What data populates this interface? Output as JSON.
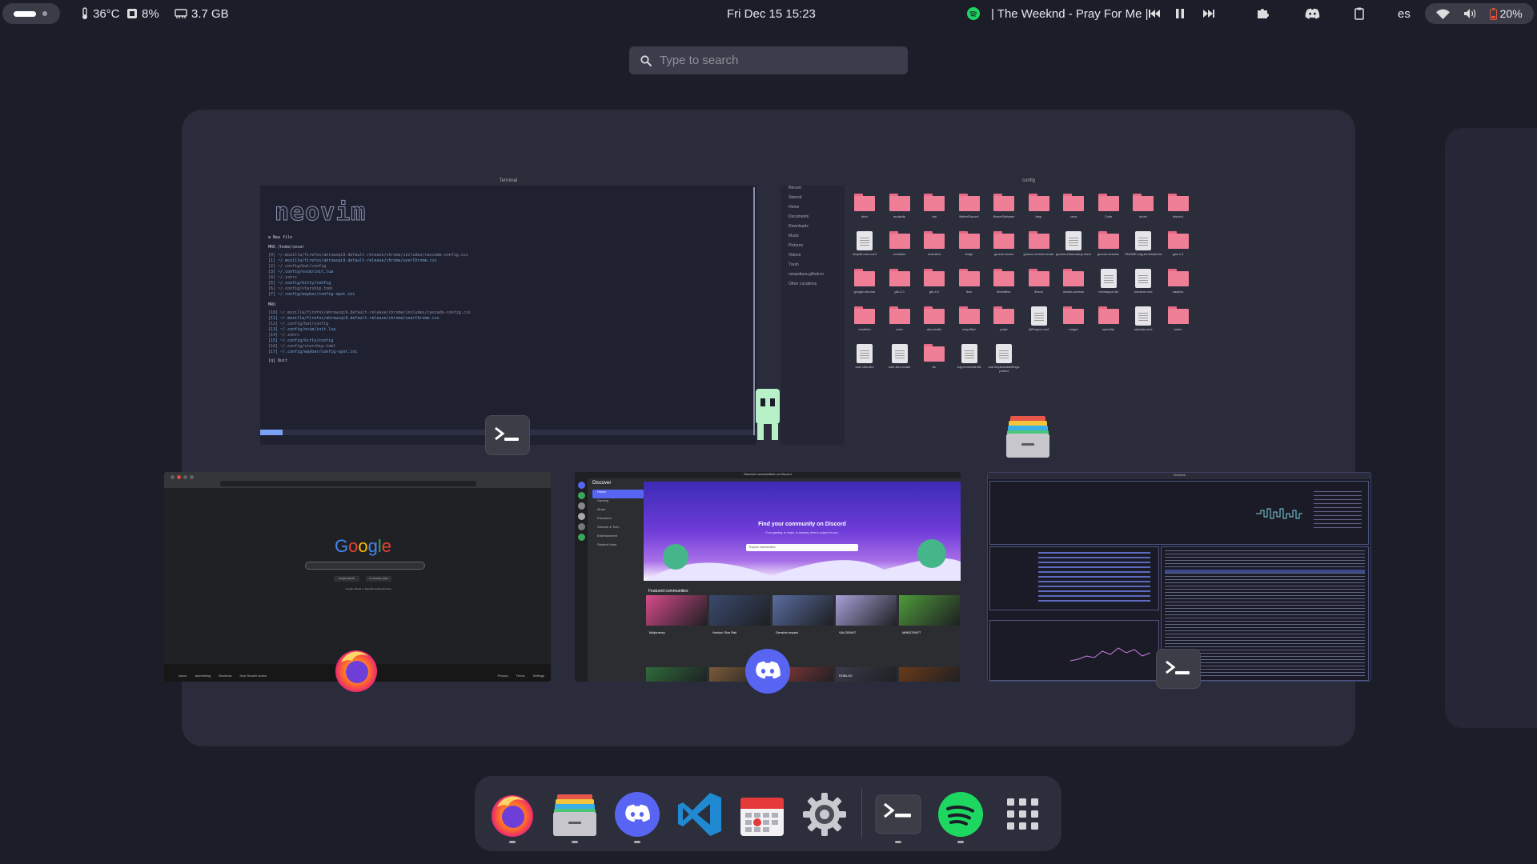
{
  "topbar": {
    "temperature": "36°C",
    "cpu": "8%",
    "memory": "3.7 GB",
    "clock": "Fri Dec 15  15:23",
    "now_playing": "| The Weeknd  -  Pray For Me |",
    "language": "es",
    "battery": "20%"
  },
  "search": {
    "placeholder": "Type to search"
  },
  "windows": {
    "terminal1": {
      "title": "Terminal",
      "logo": "neovim",
      "new_file": "New file",
      "mru_header": "MRU /home/cesar",
      "mru_items": [
        "[0]  ~/.mozilla/firefox/ahrowxqi9.default-release/chrome/includes/cascade-config.css",
        "[1]  ~/.mozilla/firefox/ahrowxqi9.default-release/chrome/userChrome.css",
        "[2]  ~/.config/bat/config",
        "[3]  ~/.config/nvim/init.lua",
        "[4]  ~/.zshrc",
        "[5]  ~/.config/kitty/config",
        "[6]  ~/.config/starship.toml",
        "[7]  ~/.config/waybar/config-spot.ini"
      ],
      "mru2_header": "MRU",
      "mru2_items": [
        "[10]  ~/.mozilla/firefox/ahrowxqi9.default-release/chrome/includes/cascade-config.css",
        "[11]  ~/.mozilla/firefox/ahrowxqi9.default-release/chrome/userChrome.css",
        "[12]  ~/.config/bat/config",
        "[13]  ~/.config/nvim/init.lua",
        "[14]  ~/.zshrc",
        "[15]  ~/.config/kitty/config",
        "[16]  ~/.config/starship.toml",
        "[17]  ~/.config/waybar/config-spot.ini"
      ],
      "quit": "[q]  Quit",
      "mode": "NORMAL"
    },
    "files": {
      "title": "config",
      "sidebar": [
        "Recent",
        "Starred",
        "Home",
        "Documents",
        "Downloads",
        "Music",
        "Pictures",
        "Videos",
        "Trash",
        "ceepottura.github.io",
        "Other Locations"
      ],
      "items": [
        {
          "name": "alert",
          "kind": "folder"
        },
        {
          "name": "audacity",
          "kind": "folder"
        },
        {
          "name": "bat",
          "kind": "folder"
        },
        {
          "name": "BetterDiscord",
          "kind": "folder"
        },
        {
          "name": "BraveSoftware",
          "kind": "folder"
        },
        {
          "name": "btop",
          "kind": "folder"
        },
        {
          "name": "cava",
          "kind": "folder"
        },
        {
          "name": "Code",
          "kind": "folder"
        },
        {
          "name": "dconf",
          "kind": "folder"
        },
        {
          "name": "discord",
          "kind": "folder"
        },
        {
          "name": "dmydir-user.conf",
          "kind": "file"
        },
        {
          "name": "evolution",
          "kind": "folder"
        },
        {
          "name": "evolution",
          "kind": "folder"
        },
        {
          "name": "fonge",
          "kind": "folder"
        },
        {
          "name": "gnome-boxes",
          "kind": "folder"
        },
        {
          "name": "gnome-control-center",
          "kind": "folder"
        },
        {
          "name": "gnome-initial-setup-done",
          "kind": "file"
        },
        {
          "name": "gnome-session",
          "kind": "folder"
        },
        {
          "name": "GNOME-xdg-terminals.list",
          "kind": "file"
        },
        {
          "name": "goa-1.0",
          "kind": "folder"
        },
        {
          "name": "google-chrome",
          "kind": "folder"
        },
        {
          "name": "gtk-2.0",
          "kind": "folder"
        },
        {
          "name": "gtk-4.0",
          "kind": "folder"
        },
        {
          "name": "ibus",
          "kind": "folder"
        },
        {
          "name": "libreoffice",
          "kind": "folder"
        },
        {
          "name": "libsoil",
          "kind": "folder"
        },
        {
          "name": "media-controls",
          "kind": "folder"
        },
        {
          "name": "mimeapps.list",
          "kind": "file"
        },
        {
          "name": "monitors.xml",
          "kind": "file"
        },
        {
          "name": "nautilus",
          "kind": "folder"
        },
        {
          "name": "neofetch",
          "kind": "folder"
        },
        {
          "name": "nvim",
          "kind": "folder"
        },
        {
          "name": "obs-studio",
          "kind": "folder"
        },
        {
          "name": "onlyoffice",
          "kind": "folder"
        },
        {
          "name": "pulse",
          "kind": "folder"
        },
        {
          "name": "QtProject.conf",
          "kind": "file"
        },
        {
          "name": "ranger",
          "kind": "folder"
        },
        {
          "name": "spicetify",
          "kind": "folder"
        },
        {
          "name": "starship.toml",
          "kind": "file"
        },
        {
          "name": "totem",
          "kind": "folder"
        },
        {
          "name": "user-dirs.dirs",
          "kind": "file"
        },
        {
          "name": "user-dirs.locale",
          "kind": "file"
        },
        {
          "name": "vlc",
          "kind": "folder"
        },
        {
          "name": "xdg-terminals.list",
          "kind": "file"
        },
        {
          "name": ".zsh-keyboardsettings-ported",
          "kind": "file"
        }
      ]
    },
    "chrome": {
      "logo": "Google",
      "btn1": "Google Search",
      "btn2": "I'm Feeling Lucky",
      "lang_text": "Google offered in:  Español (Latinoamérica)",
      "footer_left": [
        "About",
        "Advertising",
        "Business",
        "How Search works"
      ],
      "footer_right": [
        "Privacy",
        "Terms",
        "Settings"
      ]
    },
    "discord": {
      "title": "Discord",
      "window_title": "Discover communities on Discord",
      "header": "Discover",
      "nav": [
        "Home",
        "Gaming",
        "Music",
        "Education",
        "Science & Tech",
        "Entertainment",
        "Student Hubs"
      ],
      "hero_title": "Find your community on Discord",
      "hero_sub": "From gaming, to music, to learning, there's a place for you.",
      "hero_input": "Explore communities",
      "featured": "Featured communities",
      "communities": [
        "Midjourney",
        "Honkai: Star Rail",
        "Genshin Impact",
        "VALORANT",
        "MINECRAFT",
        "",
        "",
        "",
        "ROBLOX",
        ""
      ]
    },
    "btop": {
      "title": "Terminal"
    }
  },
  "dock": {
    "items": [
      "firefox-icon",
      "files-icon",
      "discord-icon",
      "vscode-icon",
      "calendar-icon",
      "settings-icon",
      "terminal-icon",
      "spotify-icon",
      "app-grid-icon"
    ]
  },
  "colors": {
    "background": "#1b1d29",
    "workspace": "#2a2c3b",
    "folder": "#ef7e97",
    "spotify": "#1ed760",
    "discord": "#5865f2",
    "battery_low": "#e5533c"
  }
}
